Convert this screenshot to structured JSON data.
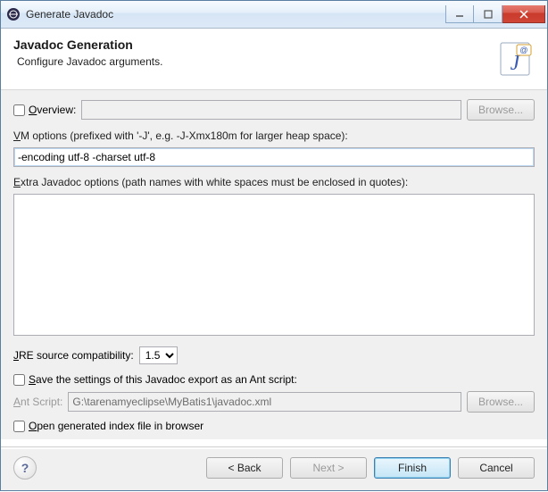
{
  "window": {
    "title": "Generate Javadoc"
  },
  "header": {
    "title": "Javadoc Generation",
    "subtitle": "Configure Javadoc arguments."
  },
  "overview": {
    "checkbox_label_pre": "O",
    "checkbox_label_post": "verview:",
    "browse_label": "Browse..."
  },
  "vm": {
    "label_pre": "V",
    "label_post": "M options (prefixed with '-J', e.g. -J-Xmx180m for larger heap space):",
    "value": "-encoding utf-8 -charset utf-8"
  },
  "extra": {
    "label_pre": "E",
    "label_post": "xtra Javadoc options (path names with white spaces must be enclosed in quotes):",
    "value": ""
  },
  "jre": {
    "label_pre": "J",
    "label_post": "RE source compatibility:",
    "value": "1.5"
  },
  "save_ant": {
    "label_pre": "S",
    "label_post": "ave the settings of this Javadoc export as an Ant script:"
  },
  "ant_script": {
    "label_pre": "A",
    "label_post": "nt Script:",
    "value": "G:\\tarenamyeclipse\\MyBatis1\\javadoc.xml",
    "browse_label": "Browse..."
  },
  "open_index": {
    "label_pre": "O",
    "label_post": "pen generated index file in browser"
  },
  "footer": {
    "back": "< Back",
    "next": "Next >",
    "finish": "Finish",
    "cancel": "Cancel"
  }
}
